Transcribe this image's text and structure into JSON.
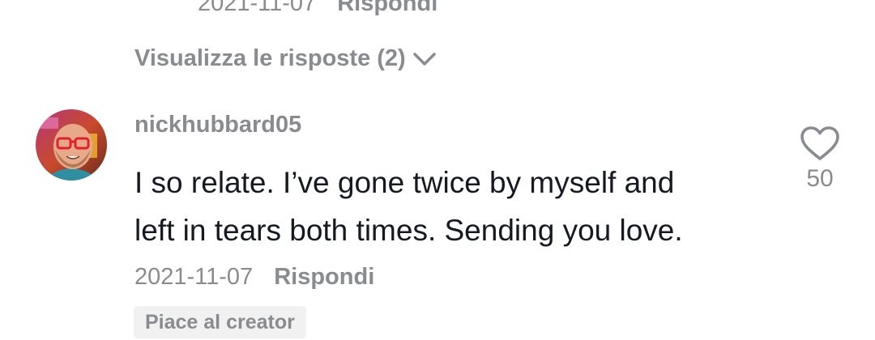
{
  "previous_comment": {
    "date": "2021-11-07",
    "reply_label": "Rispondi"
  },
  "view_replies": {
    "label": "Visualizza le risposte (2)",
    "icon": "chevron-down-icon"
  },
  "comment": {
    "username": "nickhubbard05",
    "text_lines": [
      "I so relate. I’ve gone twice by myself and",
      "left in tears both times. Sending you love."
    ],
    "date": "2021-11-07",
    "reply_label": "Rispondi",
    "creator_badge": "Piace al creator",
    "like_count": "50",
    "like_icon": "heart-outline-icon"
  },
  "colors": {
    "primary_text": "#161823",
    "secondary_text": "#8a8b91",
    "badge_background": "#f1f1f2"
  }
}
